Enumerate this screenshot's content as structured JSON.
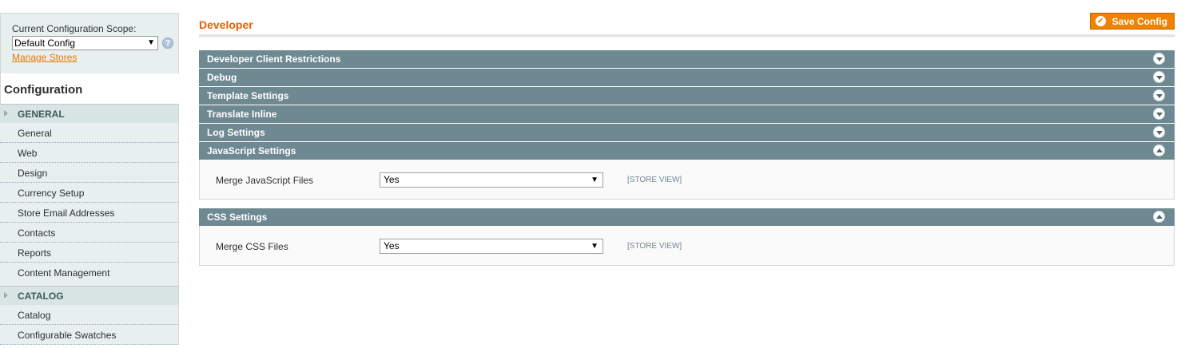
{
  "sidebar": {
    "scope_label": "Current Configuration Scope:",
    "scope_value": "Default Config",
    "manage_stores": "Manage Stores",
    "config_title": "Configuration",
    "groups": [
      {
        "label": "GENERAL",
        "items": [
          "General",
          "Web",
          "Design",
          "Currency Setup",
          "Store Email Addresses",
          "Contacts",
          "Reports",
          "Content Management"
        ]
      },
      {
        "label": "CATALOG",
        "items": [
          "Catalog",
          "Configurable Swatches"
        ]
      }
    ]
  },
  "main": {
    "title": "Developer",
    "save_label": "Save Config",
    "sections": [
      {
        "label": "Developer Client Restrictions",
        "expanded": false
      },
      {
        "label": "Debug",
        "expanded": false
      },
      {
        "label": "Template Settings",
        "expanded": false
      },
      {
        "label": "Translate Inline",
        "expanded": false
      },
      {
        "label": "Log Settings",
        "expanded": false
      },
      {
        "label": "JavaScript Settings",
        "expanded": true,
        "field": {
          "label": "Merge JavaScript Files",
          "value": "Yes",
          "scope": "[STORE VIEW]"
        }
      },
      {
        "label": "CSS Settings",
        "expanded": true,
        "field": {
          "label": "Merge CSS Files",
          "value": "Yes",
          "scope": "[STORE VIEW]"
        }
      }
    ]
  },
  "colors": {
    "accent": "#eb5e00",
    "section_header": "#6f8992",
    "button": "#f18200"
  }
}
